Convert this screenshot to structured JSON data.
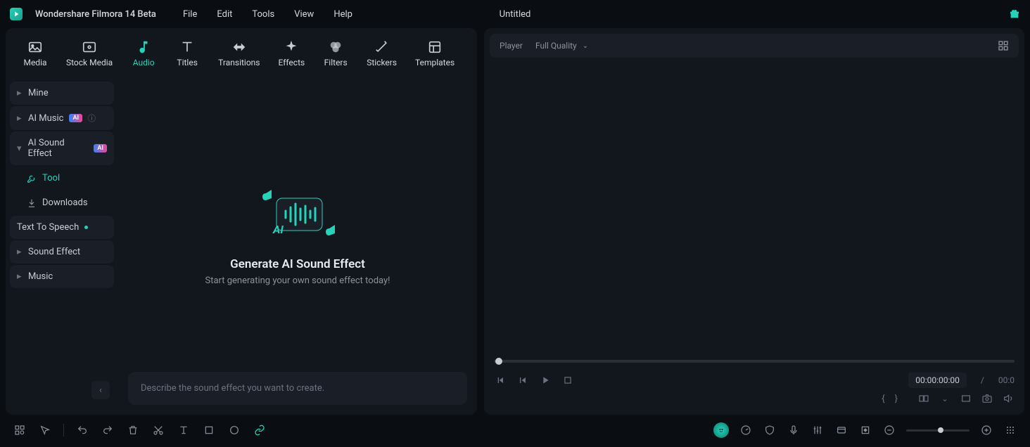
{
  "app": {
    "title": "Wondershare Filmora 14 Beta"
  },
  "menu": {
    "file": "File",
    "edit": "Edit",
    "tools": "Tools",
    "view": "View",
    "help": "Help"
  },
  "document": {
    "title": "Untitled"
  },
  "tabs": {
    "media": "Media",
    "stock": "Stock Media",
    "audio": "Audio",
    "titles": "Titles",
    "transitions": "Transitions",
    "effects": "Effects",
    "filters": "Filters",
    "stickers": "Stickers",
    "templates": "Templates"
  },
  "sidebar": {
    "mine": "Mine",
    "ai_music": "AI Music",
    "ai_sound_effect": "AI Sound Effect",
    "tool": "Tool",
    "downloads": "Downloads",
    "tts": "Text To Speech",
    "sound_effect": "Sound Effect",
    "music": "Music",
    "ai_badge": "AI"
  },
  "hero": {
    "title": "Generate AI Sound Effect",
    "subtitle": "Start generating your own sound effect today!"
  },
  "prompt": {
    "placeholder": "Describe the sound effect you want to create."
  },
  "player": {
    "label": "Player",
    "quality": "Full Quality",
    "timecode": "00:00:00:00",
    "total": "00:0",
    "slash": "/"
  },
  "braces": {
    "open": "{",
    "close": "}"
  }
}
